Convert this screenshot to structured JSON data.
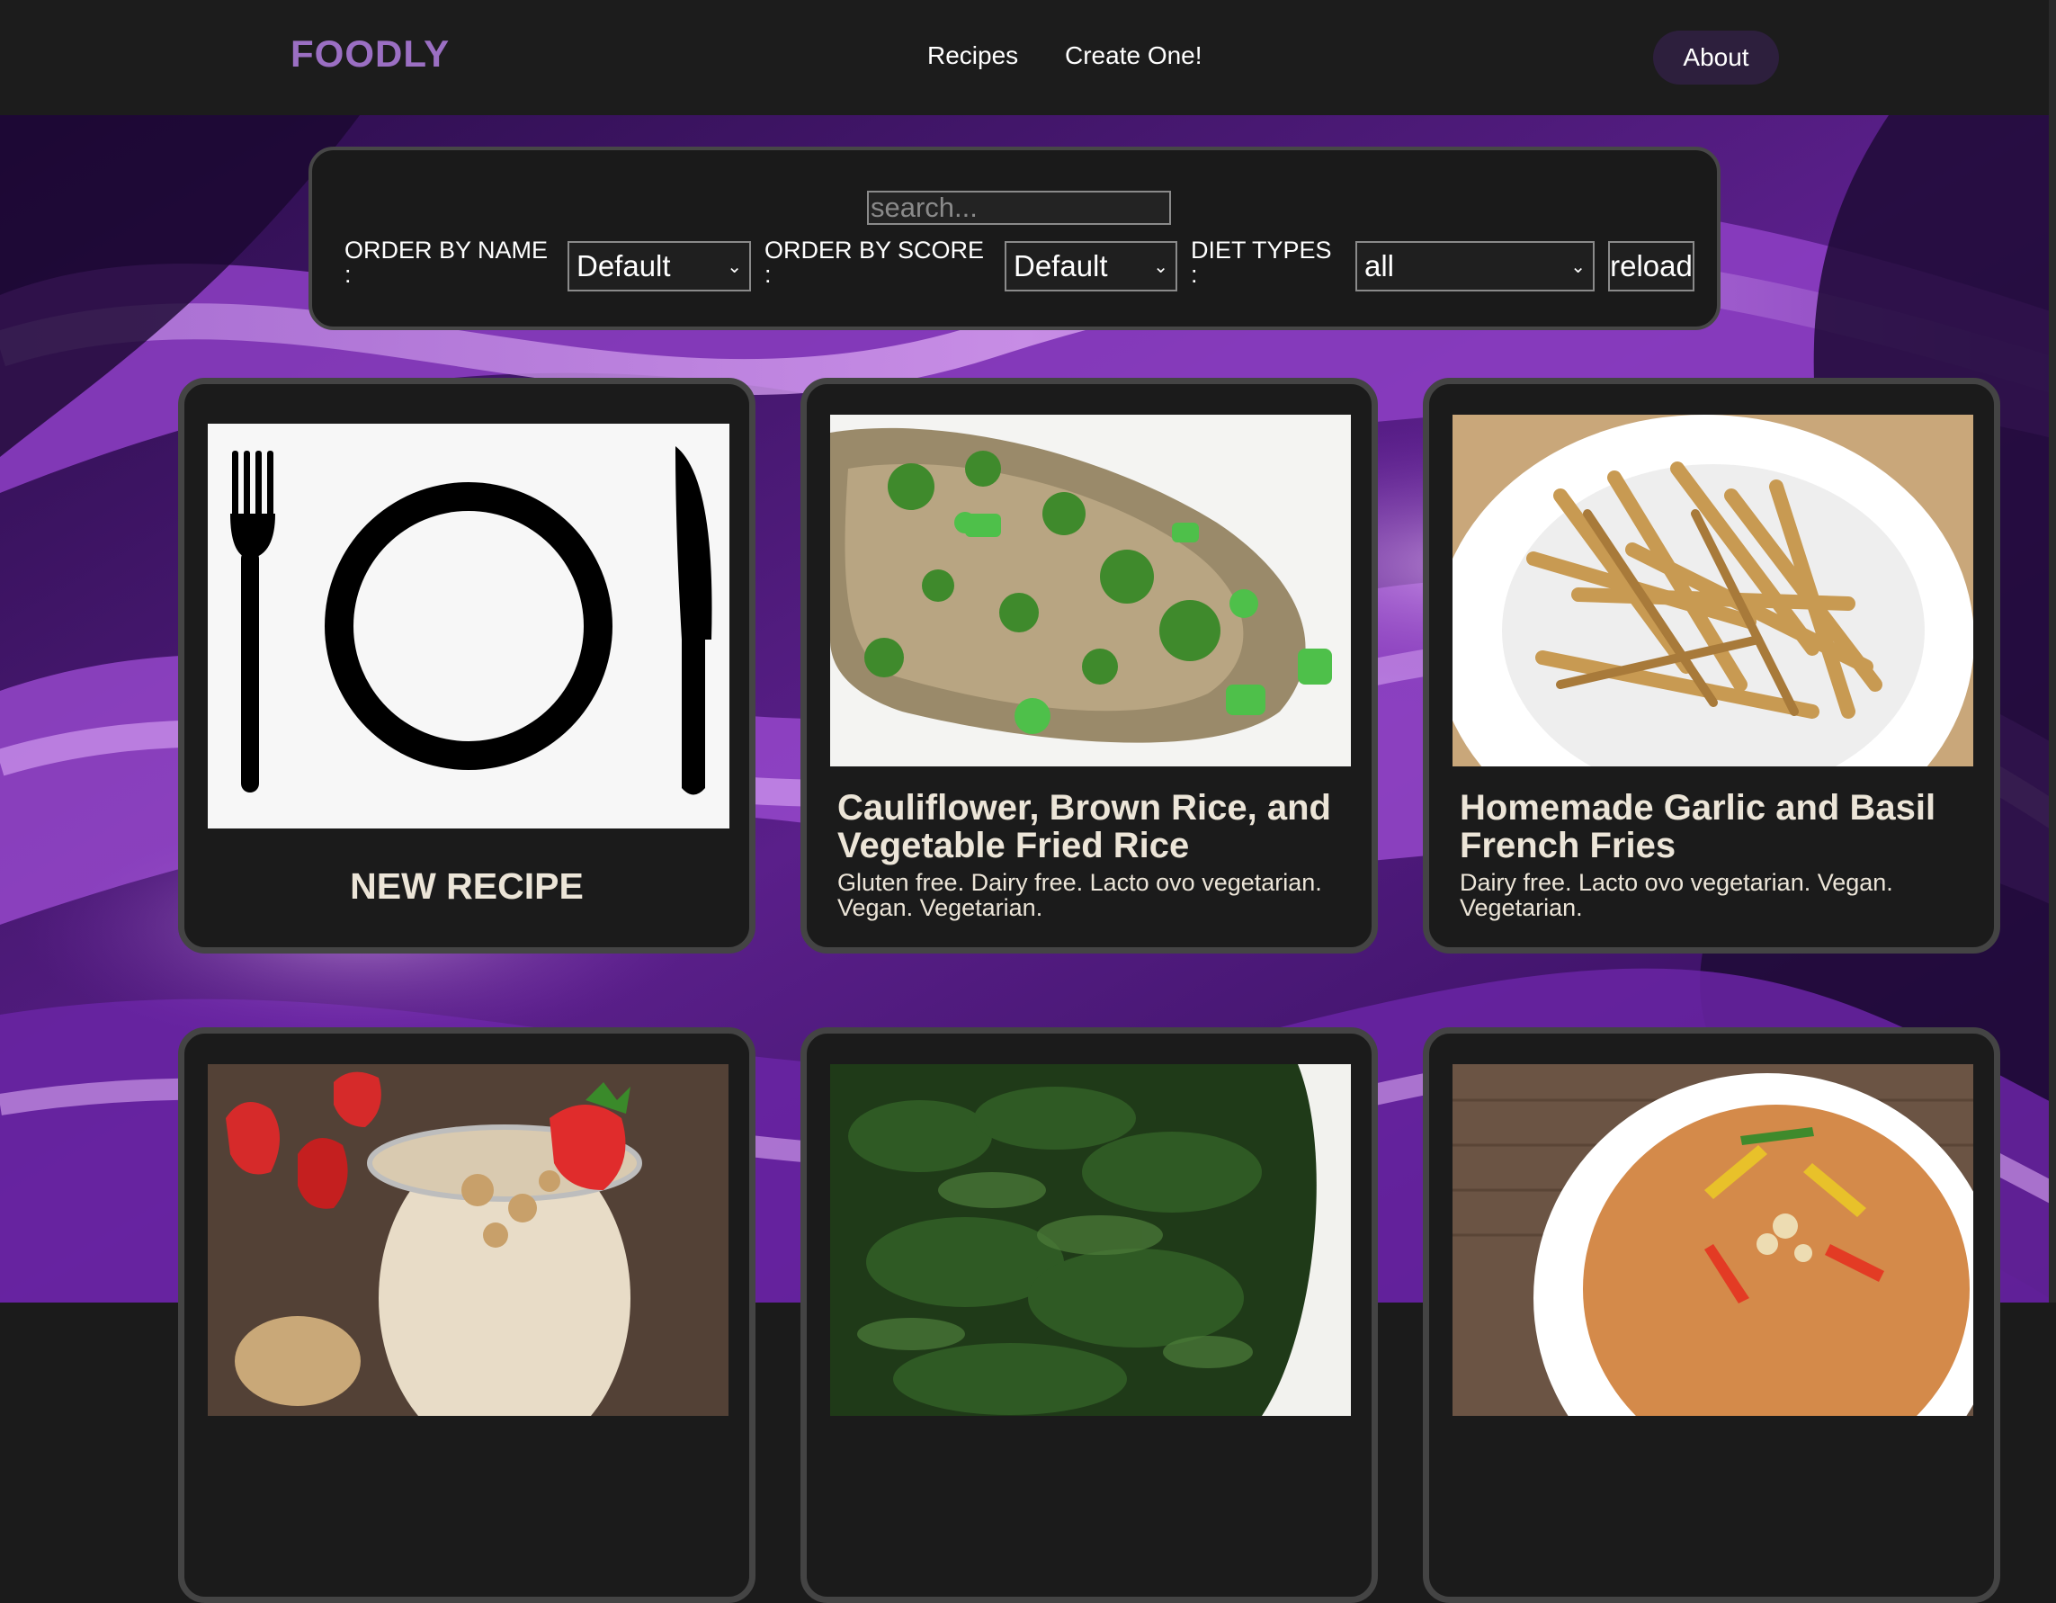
{
  "navbar": {
    "logo": "FOODLY",
    "links": [
      "Recipes",
      "Create One!"
    ],
    "about": "About"
  },
  "filters": {
    "search_placeholder": "search...",
    "order_name_label": "ORDER BY NAME",
    "order_name_value": "Default",
    "order_score_label": "ORDER BY SCORE",
    "order_score_value": "Default",
    "diet_label": "DIET TYPES",
    "diet_value": "all",
    "colon": ":",
    "reload": "reload"
  },
  "new_recipe": {
    "label": "NEW RECIPE"
  },
  "recipes": [
    {
      "title": "Cauliflower, Brown Rice, and Vegetable Fried Rice",
      "diets": "Gluten free. Dairy free. Lacto ovo vegetarian. Vegan. Vegetarian."
    },
    {
      "title": "Homemade Garlic and Basil French Fries",
      "diets": "Dairy free. Lacto ovo vegetarian. Vegan. Vegetarian."
    },
    {
      "title": "",
      "diets": ""
    },
    {
      "title": "",
      "diets": ""
    },
    {
      "title": "",
      "diets": ""
    }
  ]
}
